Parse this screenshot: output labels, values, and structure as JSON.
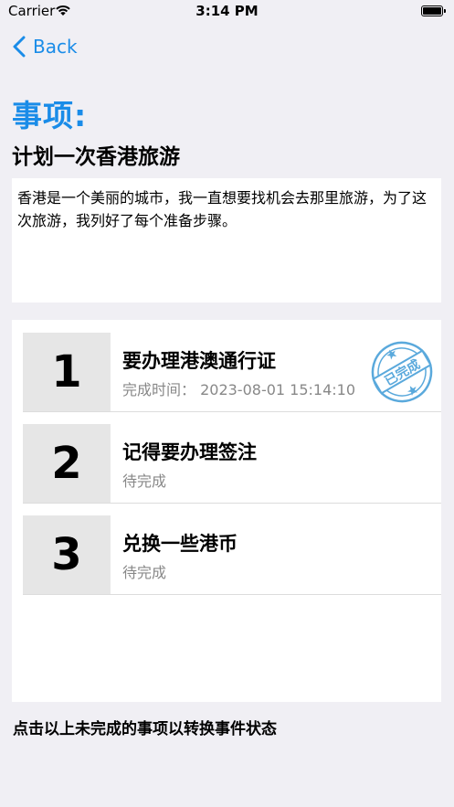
{
  "status_bar": {
    "carrier": "Carrier",
    "time": "3:14 PM"
  },
  "nav": {
    "back_label": "Back"
  },
  "page": {
    "heading": "事项:",
    "title": "计划一次香港旅游",
    "description": "香港是一个美丽的城市，我一直想要找机会去那里旅游，为了这次旅游，我列好了每个准备步骤。"
  },
  "tasks": [
    {
      "number": "1",
      "title": "要办理港澳通行证",
      "status": "完成时间：  2023-08-01 15:14:10",
      "completed": true
    },
    {
      "number": "2",
      "title": "记得要办理签注",
      "status": "待完成",
      "completed": false
    },
    {
      "number": "3",
      "title": "兑换一些港币",
      "status": "待完成",
      "completed": false
    }
  ],
  "stamp": {
    "text": "已完成",
    "color": "#5aa9dc"
  },
  "footer": {
    "hint": "点击以上未完成的事项以转换事件状态"
  },
  "colors": {
    "accent": "#1a8ce8",
    "background": "#f0eff4"
  }
}
